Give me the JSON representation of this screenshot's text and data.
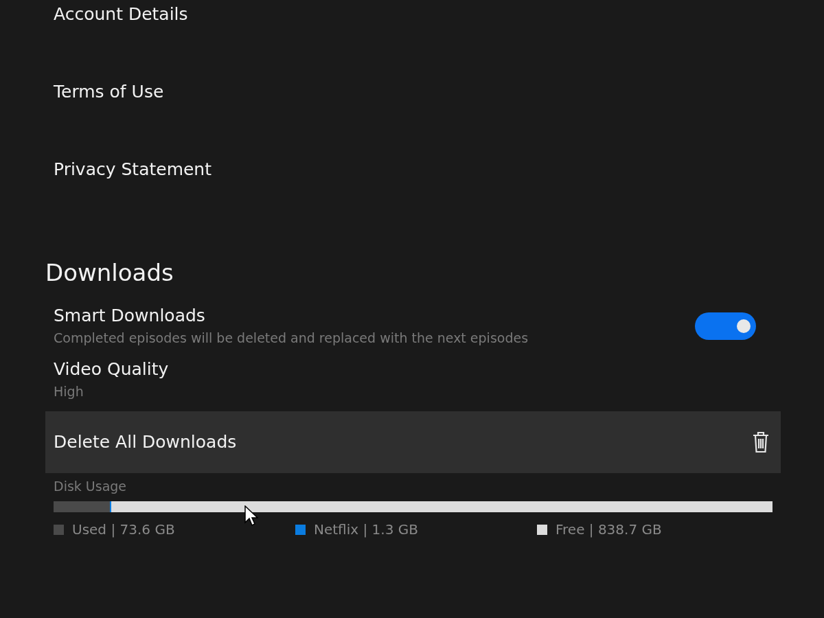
{
  "links": [
    {
      "label": "Account Details"
    },
    {
      "label": "Terms of Use"
    },
    {
      "label": "Privacy Statement"
    }
  ],
  "downloads": {
    "title": "Downloads",
    "settings": [
      {
        "kind": "toggle",
        "title": "Smart Downloads",
        "subtitle": "Completed episodes will be deleted and replaced with the next episodes",
        "on": true,
        "highlighted": false
      },
      {
        "kind": "value",
        "title": "Video Quality",
        "subtitle": "High",
        "highlighted": false
      },
      {
        "kind": "action",
        "title": "Delete All Downloads",
        "highlighted": true
      }
    ],
    "disk_usage": {
      "label": "Disk Usage",
      "bar": [
        {
          "color": "#4a4a4a",
          "level": 0.078
        },
        {
          "color": "#0a7ce0",
          "level": 0.002
        }
      ],
      "legend": [
        {
          "label": "Used | 73.6 GB",
          "color": "#4a4a4a"
        },
        {
          "label": "Netflix | 1.3 GB",
          "color": "#0a7ce0"
        },
        {
          "label": "Free | 838.7 GB",
          "color": "#dcdcdc"
        }
      ]
    }
  }
}
